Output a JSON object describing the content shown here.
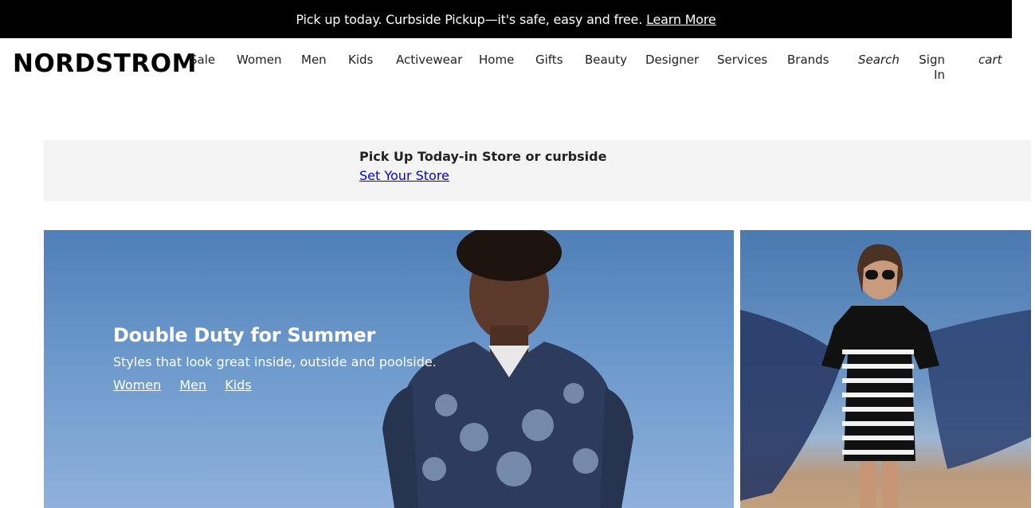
{
  "promo": {
    "text": "Pick up today. Curbside Pickup—it's safe, easy and free.",
    "link": "Learn More"
  },
  "header": {
    "logo": "NORDSTROM",
    "nav": [
      "Sale",
      "Women",
      "Men",
      "Kids",
      "Activewear",
      "Home",
      "Gifts",
      "Beauty",
      "Designer",
      "Services",
      "Brands"
    ],
    "search": "Search",
    "signin": "Sign In",
    "cart": "cart"
  },
  "store": {
    "title": "Pick Up Today-in Store or curbside",
    "link": "Set Your Store"
  },
  "hero": {
    "title": "Double Duty for Summer",
    "subtitle": "Styles that look great inside, outside and poolside.",
    "links": [
      "Women",
      "Men",
      "Kids"
    ]
  },
  "colors": {
    "promo_bg": "#000000",
    "store_bg": "#f4f4f4",
    "link": "#0000ee",
    "sky": "#6b98cb"
  }
}
